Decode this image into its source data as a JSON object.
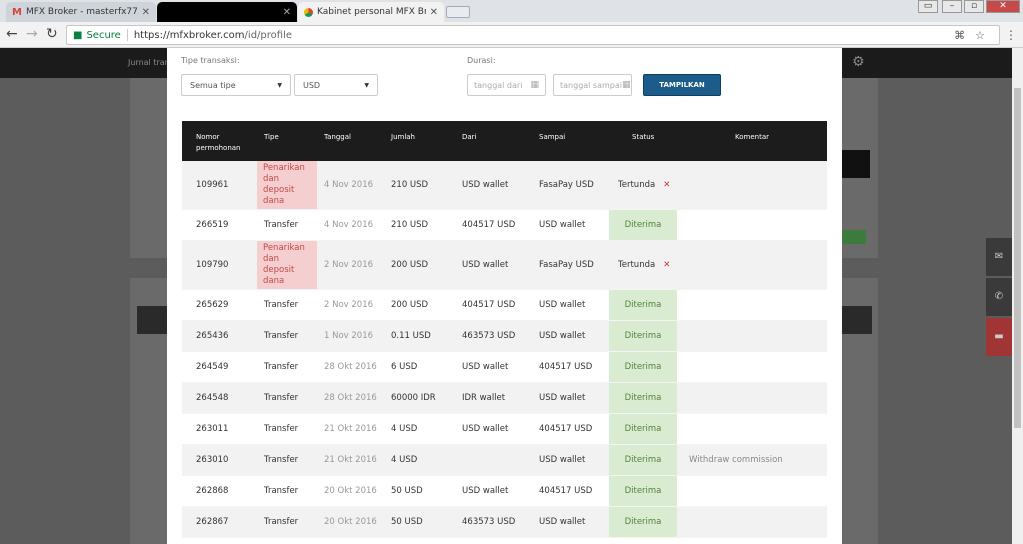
{
  "browser": {
    "tabs": [
      {
        "title": "MFX Broker - masterfx77",
        "icon": "gmail-icon"
      },
      {
        "title": "",
        "icon": ""
      },
      {
        "title": "Kabinet personal MFX Br",
        "icon": "chrome-favicon"
      }
    ],
    "secure_label": "Secure",
    "url_host": "https://mfxbroker.com",
    "url_path": "/id/profile"
  },
  "site": {
    "nav_link": "Jurnal transaksi"
  },
  "filters": {
    "type_label": "Tipe transaksi:",
    "type_value": "Semua tipe",
    "currency_value": "USD",
    "duration_label": "Durasi:",
    "date_from_placeholder": "tanggal dari",
    "date_to_placeholder": "tanggal sampai",
    "show_button": "TAMPILKAN"
  },
  "table": {
    "headers": {
      "number": "Nomor permohonan",
      "type": "Tipe",
      "date": "Tanggal",
      "amount": "Jumlah",
      "from": "Dari",
      "to": "Sampai",
      "status": "Status",
      "comment": "Komentar"
    },
    "rows": [
      {
        "number": "109961",
        "type": "Penarikan dan deposit dana",
        "date": "4 Nov 2016",
        "amount": "210 USD",
        "from": "USD wallet",
        "to": "FasaPay USD",
        "status": "Tertunda",
        "comment": ""
      },
      {
        "number": "266519",
        "type": "Transfer",
        "date": "4 Nov 2016",
        "amount": "210 USD",
        "from": "404517 USD",
        "to": "USD wallet",
        "status": "Diterima",
        "comment": ""
      },
      {
        "number": "109790",
        "type": "Penarikan dan deposit dana",
        "date": "2 Nov 2016",
        "amount": "200 USD",
        "from": "USD wallet",
        "to": "FasaPay USD",
        "status": "Tertunda",
        "comment": ""
      },
      {
        "number": "265629",
        "type": "Transfer",
        "date": "2 Nov 2016",
        "amount": "200 USD",
        "from": "404517 USD",
        "to": "USD wallet",
        "status": "Diterima",
        "comment": ""
      },
      {
        "number": "265436",
        "type": "Transfer",
        "date": "1 Nov 2016",
        "amount": "0.11 USD",
        "from": "463573 USD",
        "to": "USD wallet",
        "status": "Diterima",
        "comment": ""
      },
      {
        "number": "264549",
        "type": "Transfer",
        "date": "28 Okt 2016",
        "amount": "6 USD",
        "from": "USD wallet",
        "to": "404517 USD",
        "status": "Diterima",
        "comment": ""
      },
      {
        "number": "264548",
        "type": "Transfer",
        "date": "28 Okt 2016",
        "amount": "60000 IDR",
        "from": "IDR wallet",
        "to": "USD wallet",
        "status": "Diterima",
        "comment": ""
      },
      {
        "number": "263011",
        "type": "Transfer",
        "date": "21 Okt 2016",
        "amount": "4 USD",
        "from": "USD wallet",
        "to": "404517 USD",
        "status": "Diterima",
        "comment": ""
      },
      {
        "number": "263010",
        "type": "Transfer",
        "date": "21 Okt 2016",
        "amount": "4 USD",
        "from": "",
        "to": "USD wallet",
        "status": "Diterima",
        "comment": "Withdraw commission"
      },
      {
        "number": "262868",
        "type": "Transfer",
        "date": "20 Okt 2016",
        "amount": "50 USD",
        "from": "USD wallet",
        "to": "404517 USD",
        "status": "Diterima",
        "comment": ""
      },
      {
        "number": "262867",
        "type": "Transfer",
        "date": "20 Okt 2016",
        "amount": "50 USD",
        "from": "463573 USD",
        "to": "USD wallet",
        "status": "Diterima",
        "comment": ""
      }
    ]
  },
  "colors": {
    "pending_type_bg": "#f5cfcf",
    "accepted_status_bg": "#d9ecd2",
    "show_button": "#1b5c8a",
    "header_bg": "#1c1c1c"
  }
}
